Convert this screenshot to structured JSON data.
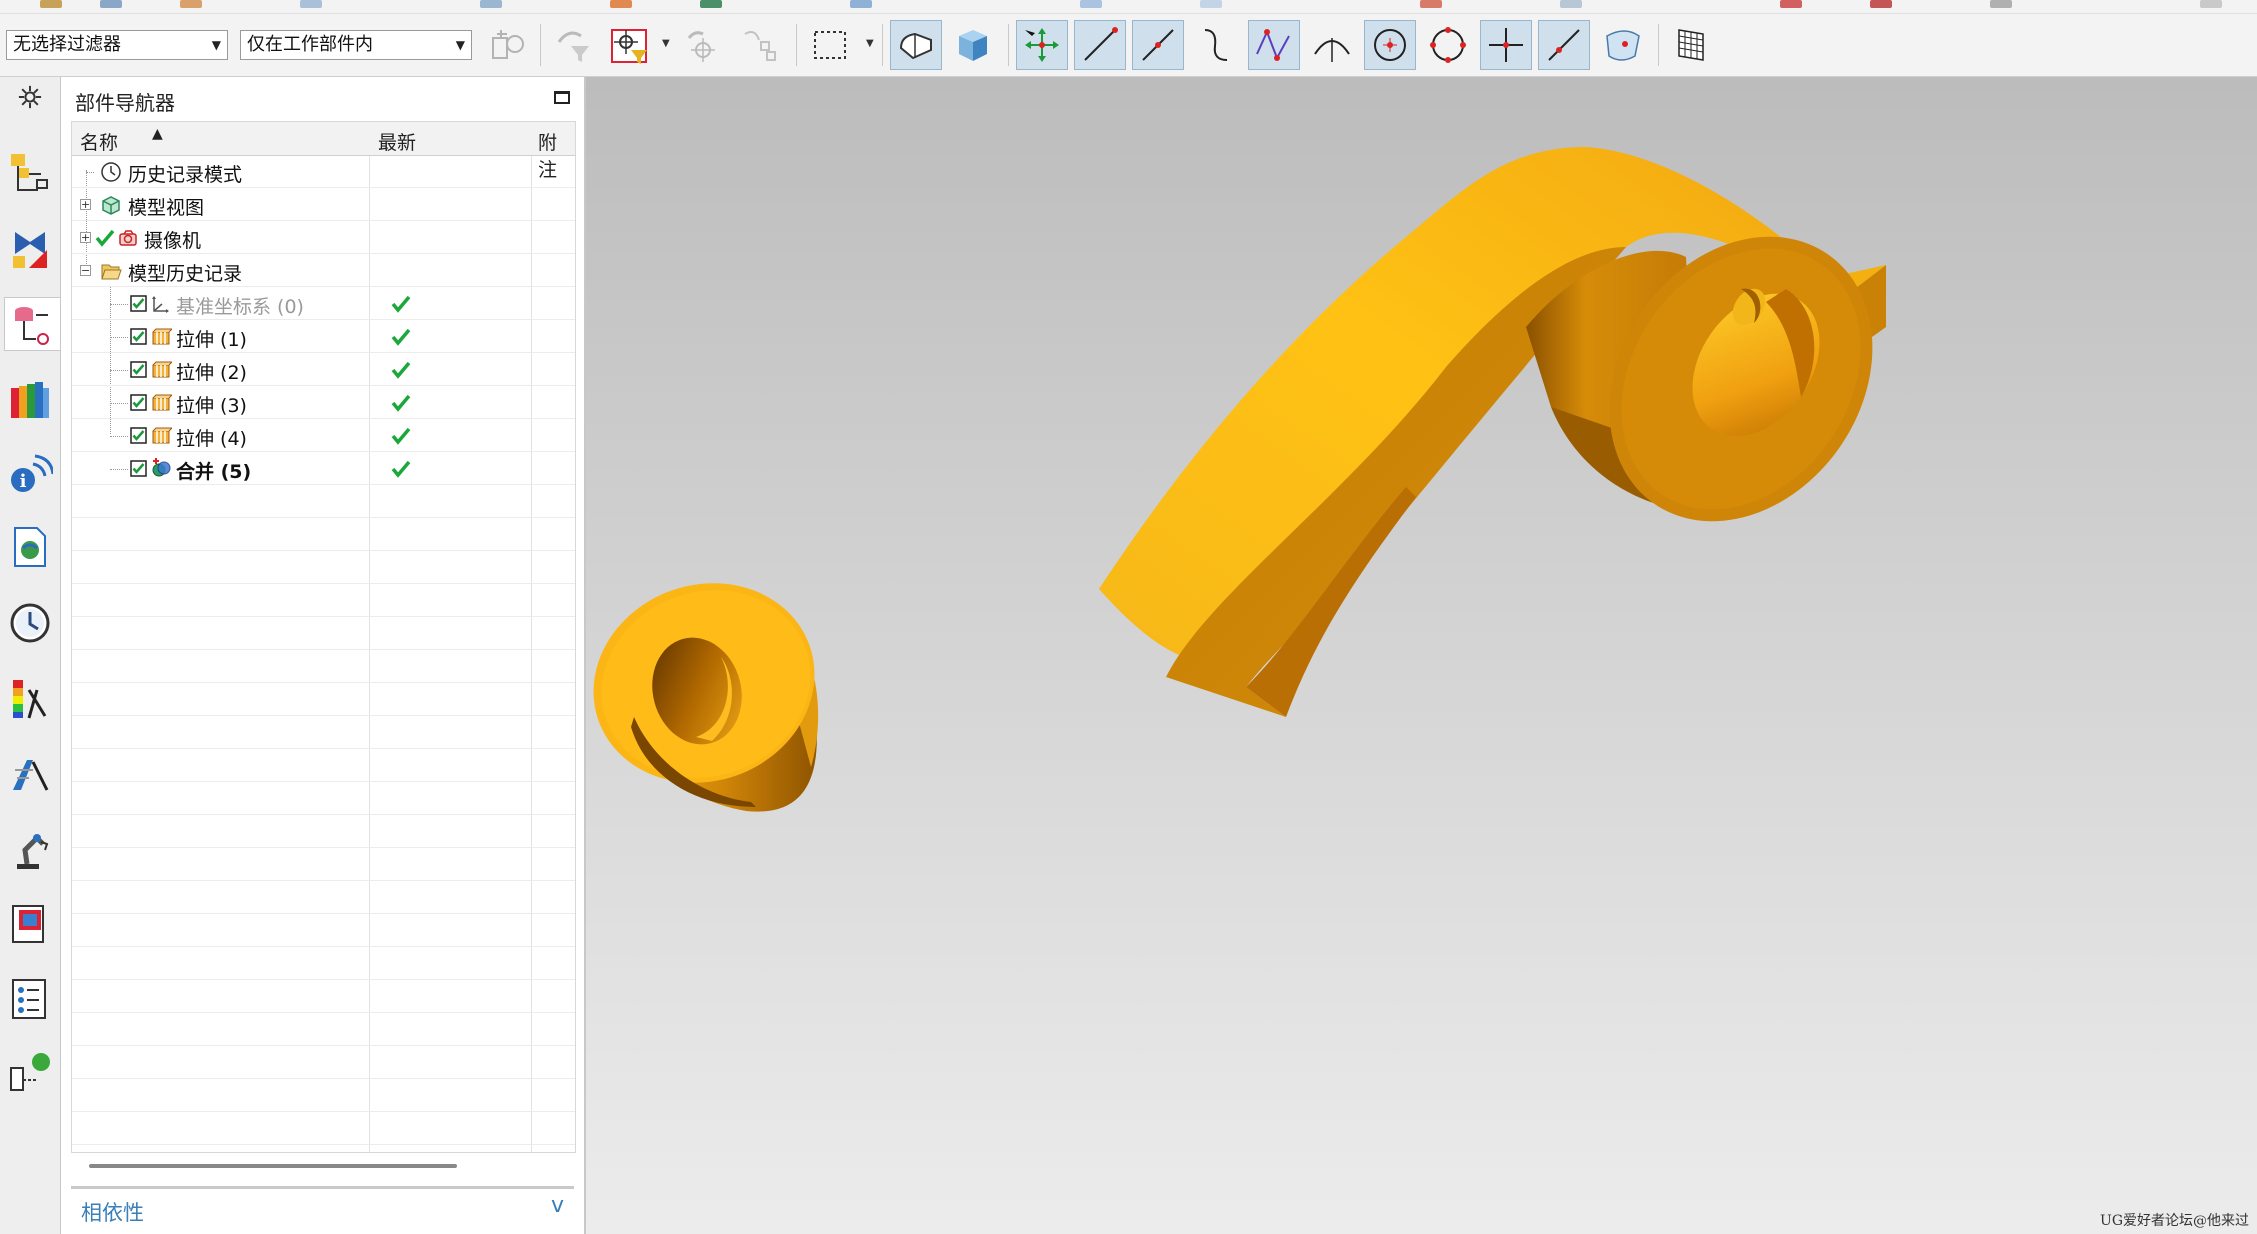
{
  "toolbar": {
    "filter_select": "无选择过滤器",
    "scope_select": "仅在工作部件内"
  },
  "navigator": {
    "title": "部件导航器",
    "columns": [
      "名称",
      "最新",
      "附注"
    ],
    "items": [
      {
        "label": "历史记录模式",
        "icon": "history-clock-icon"
      },
      {
        "label": "模型视图",
        "icon": "model-views-icon"
      },
      {
        "label": "摄像机",
        "icon": "camera-icon"
      },
      {
        "label": "模型历史记录",
        "icon": "folder-open-icon"
      },
      {
        "label": "基准坐标系 (0)",
        "icon": "datum-csys-icon",
        "latest": true
      },
      {
        "label": "拉伸 (1)",
        "icon": "extrude-icon",
        "latest": true
      },
      {
        "label": "拉伸 (2)",
        "icon": "extrude-icon",
        "latest": true
      },
      {
        "label": "拉伸 (3)",
        "icon": "extrude-icon",
        "latest": true
      },
      {
        "label": "拉伸 (4)",
        "icon": "extrude-icon",
        "latest": true
      },
      {
        "label": "合并 (5)",
        "icon": "unite-icon",
        "latest": true
      }
    ],
    "dependency_panel": "相依性"
  },
  "model": {
    "color": "#f5b21a"
  },
  "watermark": "UG爱好者论坛@他来过"
}
